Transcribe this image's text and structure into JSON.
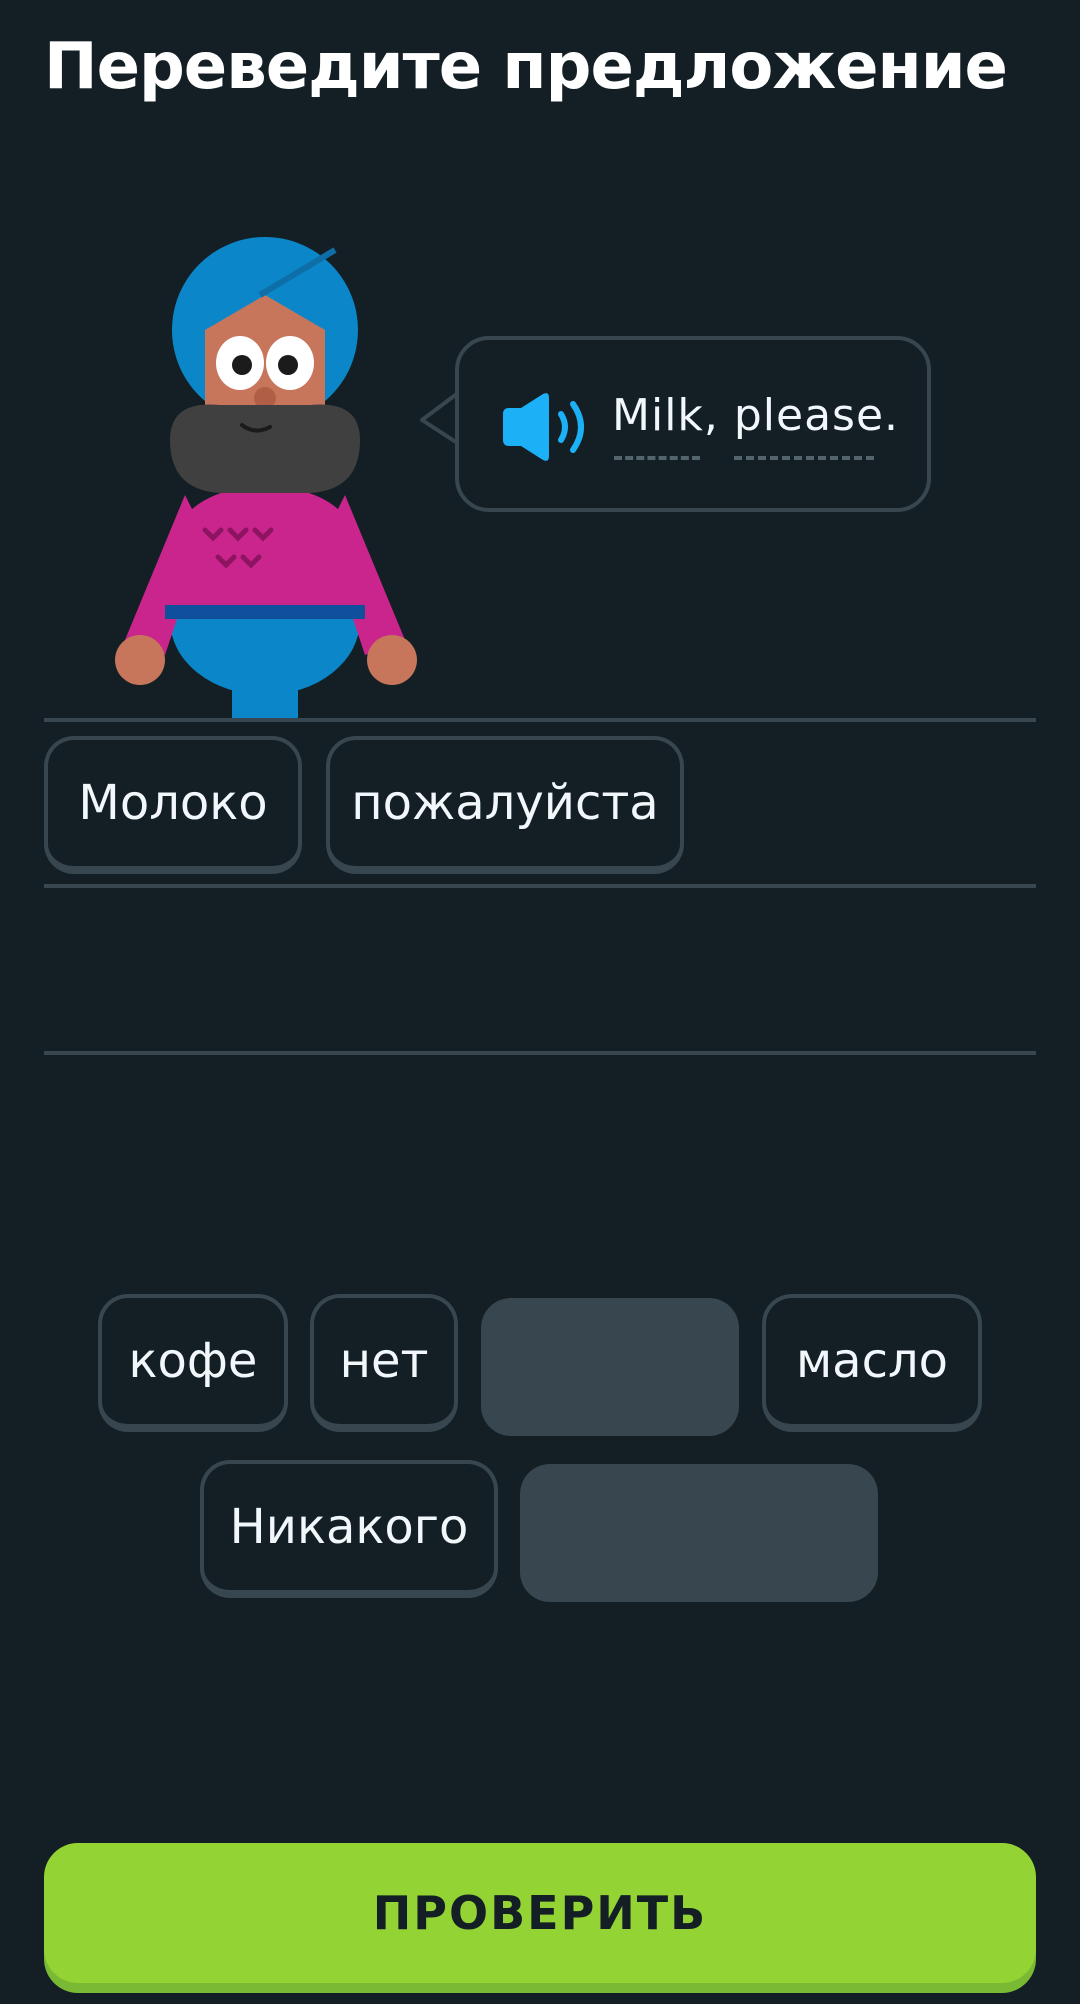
{
  "header": {
    "title": "Переведите предложение"
  },
  "prompt": {
    "speaker_icon": "speaker-icon",
    "sentence": "Milk, please.",
    "character": "turbaned-character-illustration"
  },
  "answer_area": {
    "selected_words": [
      "Молоко",
      "пожалуйста"
    ]
  },
  "word_bank": {
    "words": [
      "кофе",
      "нет",
      "масло",
      "Никакого"
    ]
  },
  "footer": {
    "check_label": "ПРОВЕРИТЬ"
  },
  "colors": {
    "background": "#131f24",
    "border": "#37464f",
    "accent_green": "#93d333",
    "speaker_blue": "#1cb0f6"
  }
}
